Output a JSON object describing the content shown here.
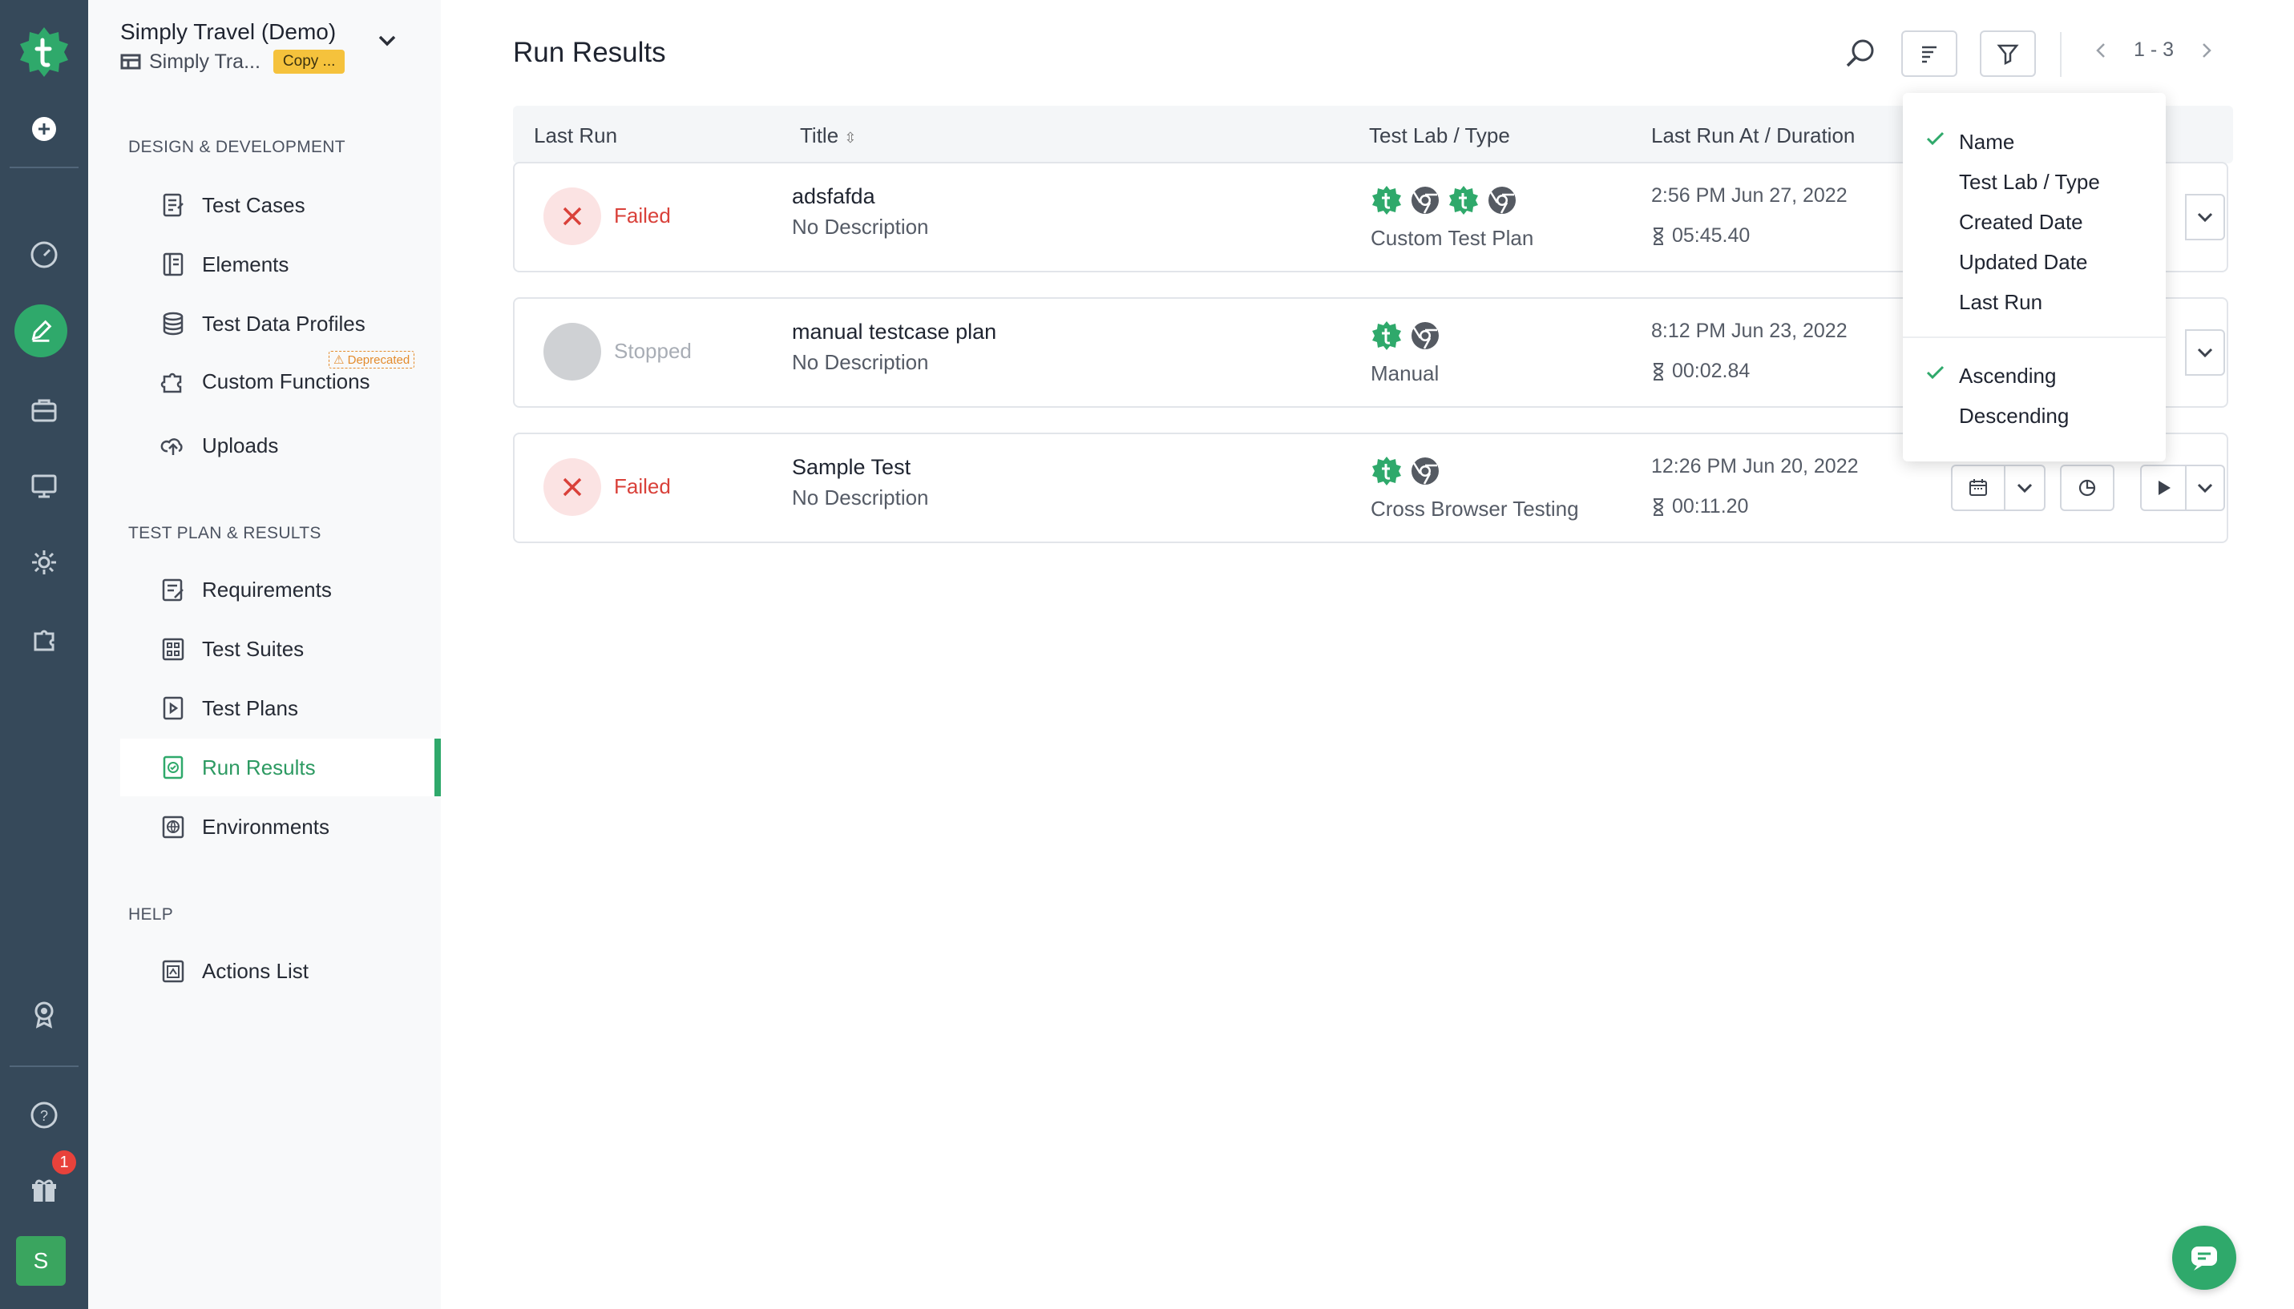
{
  "colors": {
    "rail": "#36495a",
    "accent": "#2fa96b",
    "failed": "#d9413a",
    "copy_badge": "#f5c23c"
  },
  "workspace": {
    "name": "Simply Travel (Demo)",
    "sub": "Simply Tra...",
    "copy_label": "Copy ..."
  },
  "rail": {
    "notification_count": "1",
    "avatar_initial": "S"
  },
  "sidebar": {
    "design_section": "DESIGN & DEVELOPMENT",
    "design_items": [
      {
        "label": "Test Cases",
        "icon": "test-cases-icon"
      },
      {
        "label": "Elements",
        "icon": "elements-icon"
      },
      {
        "label": "Test Data Profiles",
        "icon": "database-icon"
      },
      {
        "label": "Custom Functions",
        "icon": "puzzle-icon"
      },
      {
        "label": "Uploads",
        "icon": "cloud-upload-icon"
      }
    ],
    "deprecated_label": "Deprecated",
    "plan_section": "TEST PLAN & RESULTS",
    "plan_items": [
      {
        "label": "Requirements",
        "icon": "requirements-icon"
      },
      {
        "label": "Test Suites",
        "icon": "test-suites-icon"
      },
      {
        "label": "Test Plans",
        "icon": "test-plans-icon"
      },
      {
        "label": "Run Results",
        "icon": "run-results-icon"
      },
      {
        "label": "Environments",
        "icon": "globe-icon"
      }
    ],
    "help_section": "HELP",
    "help_items": [
      {
        "label": "Actions List",
        "icon": "actions-list-icon"
      }
    ]
  },
  "main": {
    "title": "Run Results",
    "pagination": "1 - 3",
    "columns": {
      "last_run": "Last Run",
      "title": "Title",
      "lab_type": "Test Lab / Type",
      "last_run_at": "Last Run At / Duration"
    },
    "rows": [
      {
        "status": "Failed",
        "title": "adsfafda",
        "description": "No Description",
        "lab_type": "Custom Test Plan",
        "run_at": "2:56 PM Jun 27, 2022",
        "duration": "05:45.40"
      },
      {
        "status": "Stopped",
        "title": "manual testcase plan",
        "description": "No Description",
        "lab_type": "Manual",
        "run_at": "8:12 PM Jun 23, 2022",
        "duration": "00:02.84"
      },
      {
        "status": "Failed",
        "title": "Sample Test",
        "description": "No Description",
        "lab_type": "Cross Browser Testing",
        "run_at": "12:26 PM Jun 20, 2022",
        "duration": "00:11.20"
      }
    ]
  },
  "sort_menu": {
    "fields": [
      "Name",
      "Test Lab / Type",
      "Created Date",
      "Updated Date",
      "Last Run"
    ],
    "selected_field": "Name",
    "orders": [
      "Ascending",
      "Descending"
    ],
    "selected_order": "Ascending"
  }
}
